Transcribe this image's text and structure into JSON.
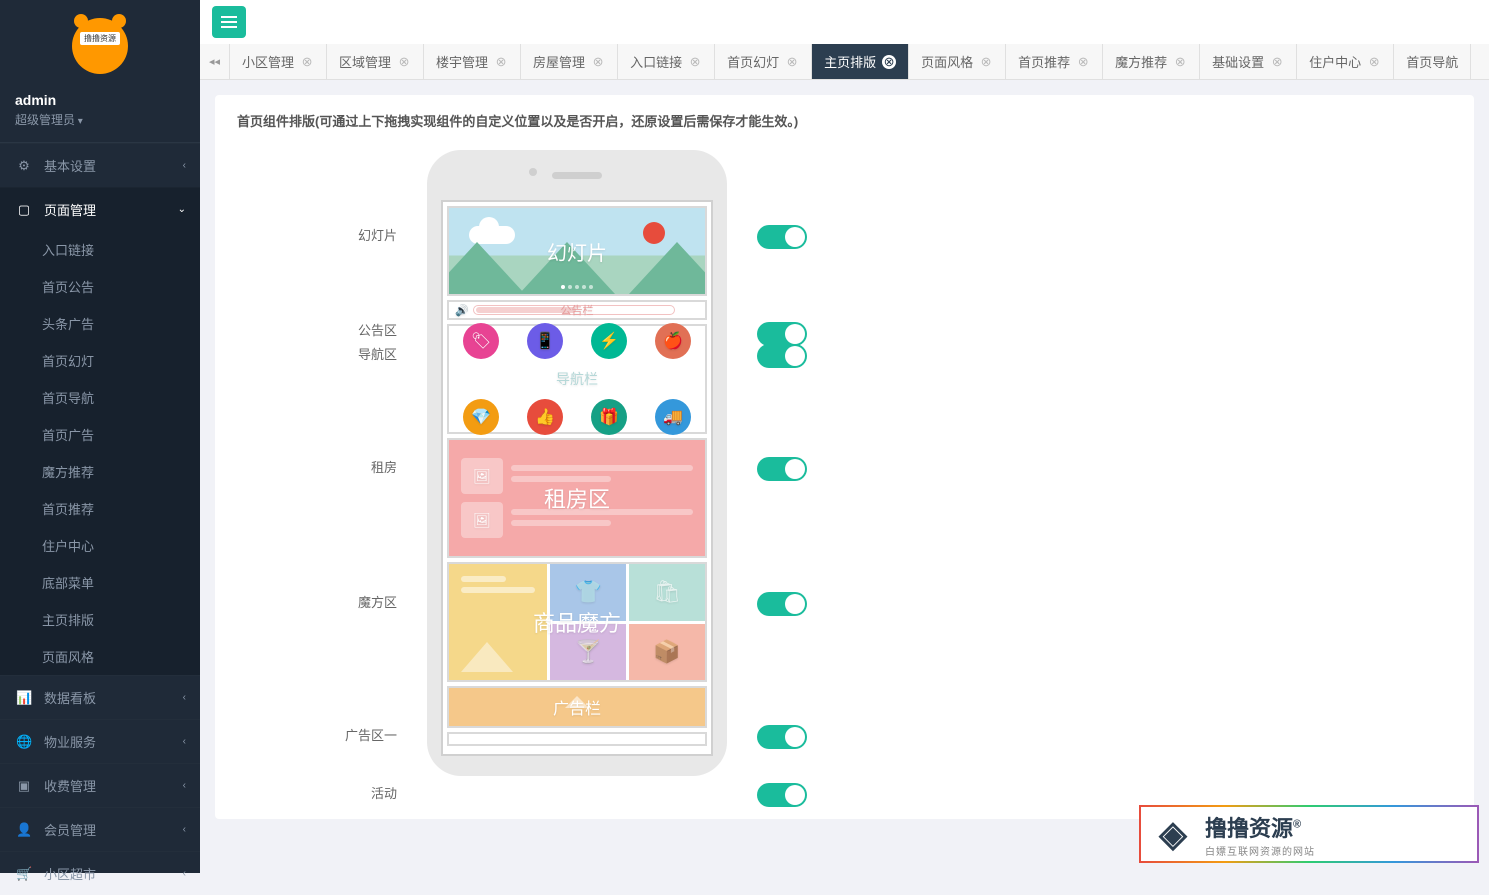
{
  "logo_text": "撸撸资源",
  "user": {
    "name": "admin",
    "role": "超级管理员"
  },
  "sidebar": {
    "items": [
      {
        "icon": "⚙",
        "label": "基本设置",
        "chev": "‹"
      },
      {
        "icon": "▢",
        "label": "页面管理",
        "chev": "⌄",
        "active": true
      },
      {
        "icon": "📊",
        "label": "数据看板",
        "chev": "‹"
      },
      {
        "icon": "🌐",
        "label": "物业服务",
        "chev": "‹"
      },
      {
        "icon": "💳",
        "label": "收费管理",
        "chev": "‹"
      },
      {
        "icon": "👤",
        "label": "会员管理",
        "chev": "‹"
      },
      {
        "icon": "🛒",
        "label": "小区超市",
        "chev": "‹"
      }
    ],
    "submenu": [
      "入口链接",
      "首页公告",
      "头条广告",
      "首页幻灯",
      "首页导航",
      "首页广告",
      "魔方推荐",
      "首页推荐",
      "住户中心",
      "底部菜单",
      "主页排版",
      "页面风格"
    ]
  },
  "tabs": [
    "小区管理",
    "区域管理",
    "楼宇管理",
    "房屋管理",
    "入口链接",
    "首页幻灯",
    "主页排版",
    "页面风格",
    "首页推荐",
    "魔方推荐",
    "基础设置",
    "住户中心",
    "首页导航"
  ],
  "active_tab": "主页排版",
  "panel_title": "首页组件排版(可通过上下拖拽实现组件的自定义位置以及是否开启，还原设置后需保存才能生效。)",
  "components": {
    "slider": {
      "label": "幻灯片",
      "block": "幻灯片"
    },
    "notice": {
      "label": "公告区",
      "block": "公告栏"
    },
    "nav": {
      "label": "导航区",
      "block": "导航栏"
    },
    "rent": {
      "label": "租房",
      "block": "租房区"
    },
    "cube": {
      "label": "魔方区",
      "block": "商品魔方"
    },
    "ad": {
      "label": "广告区一",
      "block": "广告栏"
    },
    "act": {
      "label": "活动"
    }
  },
  "watermark": {
    "title": "撸撸资源",
    "sub": "白嫖互联网资源的网站"
  }
}
